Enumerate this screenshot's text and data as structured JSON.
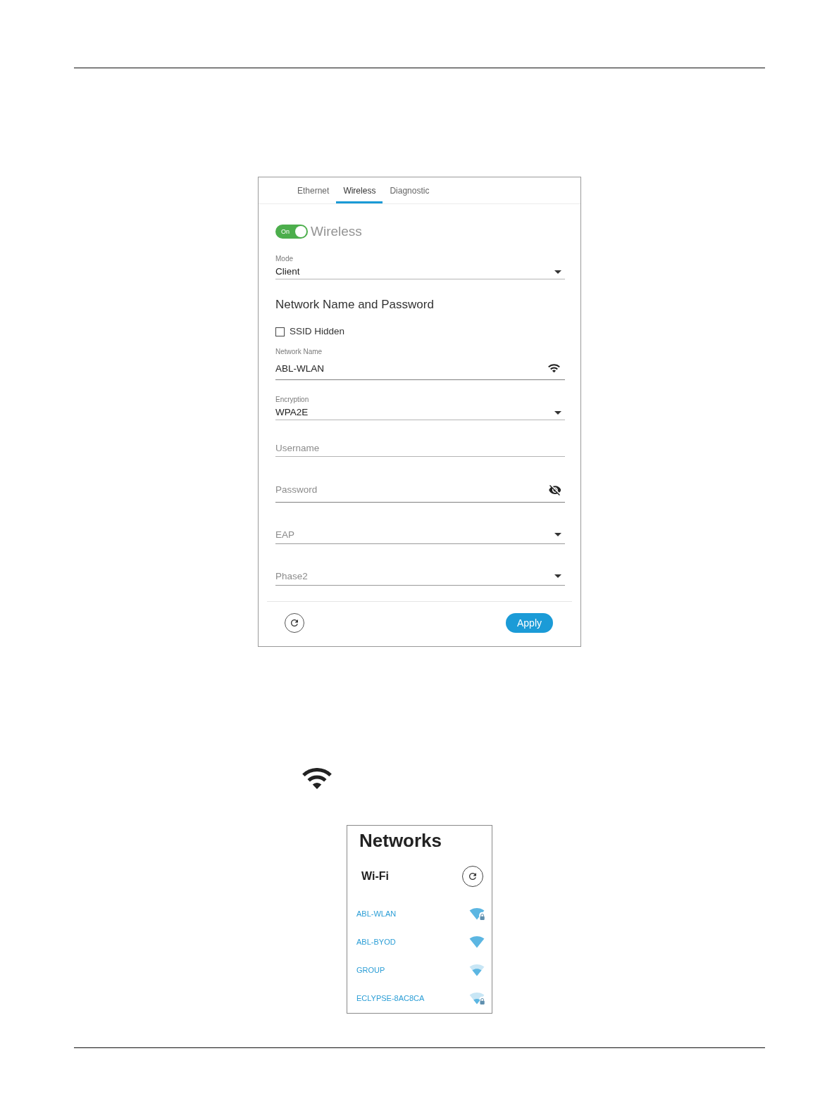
{
  "settings_panel": {
    "tabs": [
      {
        "label": "Ethernet",
        "selected": false
      },
      {
        "label": "Wireless",
        "selected": true
      },
      {
        "label": "Diagnostic",
        "selected": false
      }
    ],
    "wireless_switch": {
      "text": "On",
      "on": true,
      "label": "Wireless"
    },
    "form": [
      {
        "kind": "select",
        "label": "Mode",
        "value": "Client"
      },
      {
        "kind": "heading",
        "text": "Network Name and Password"
      },
      {
        "kind": "checkbox",
        "label": "SSID Hidden",
        "checked": false
      },
      {
        "kind": "network",
        "label": "Network Name",
        "value": "ABL-WLAN"
      },
      {
        "kind": "select",
        "label": "Encryption",
        "value": "WPA2E"
      },
      {
        "kind": "text",
        "placeholder": "Username"
      },
      {
        "kind": "password",
        "placeholder": "Password"
      },
      {
        "kind": "select",
        "placeholder": "EAP"
      },
      {
        "kind": "select",
        "placeholder": "Phase2"
      }
    ],
    "apply_button": "Apply"
  },
  "networks_panel": {
    "title": "Networks",
    "section": "Wi-Fi",
    "networks": [
      {
        "name": "ABL-WLAN",
        "kind": "strong",
        "secured": true
      },
      {
        "name": "ABL-BYOD",
        "kind": "strong",
        "secured": false
      },
      {
        "name": "GROUP",
        "kind": "medium",
        "secured": false
      },
      {
        "name": "ECLYPSE-8AC8CA",
        "kind": "weak",
        "secured": true
      }
    ]
  }
}
